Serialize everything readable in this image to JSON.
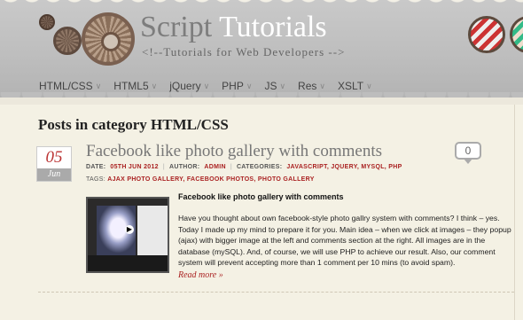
{
  "header": {
    "title_part1": "Script",
    "title_part2": "Tutorials",
    "tagline": "<!--Tutorials for Web Developers -->"
  },
  "nav": {
    "items": [
      {
        "label": "HTML/CSS"
      },
      {
        "label": "HTML5"
      },
      {
        "label": "jQuery"
      },
      {
        "label": "PHP"
      },
      {
        "label": "JS"
      },
      {
        "label": "Res"
      },
      {
        "label": "XSLT"
      }
    ],
    "chevron": "∨"
  },
  "page": {
    "heading": "Posts in category HTML/CSS"
  },
  "post": {
    "day": "05",
    "month": "Jun",
    "title": "Facebook like photo gallery with comments",
    "comment_count": "0",
    "meta": {
      "date_label": "DATE:",
      "date_value": "05TH JUN 2012",
      "author_label": "AUTHOR:",
      "author_value": "ADMIN",
      "categories_label": "CATEGORIES:",
      "categories_value": "JAVASCRIPT, JQUERY, MYSQL, PHP",
      "separator": "|"
    },
    "tags": {
      "label": "TAGS:",
      "value": "AJAX PHOTO GALLERY, FACEBOOK PHOTOS, PHOTO GALLERY"
    },
    "excerpt_title": "Facebook like photo gallery with comments",
    "excerpt": "Have you thought about own facebook-style photo gallry system with comments? I think – yes. Today I made up my mind to prepare it for you. Main idea – when we click at images – they popup (ajax) with bigger image at the left and comments section at the right. All images are in the database (mySQL). And, of course, we will use PHP to achieve our result. Also, our comment system will prevent accepting more than 1 comment per 10 mins (to avoid spam).",
    "read_more": "Read more »"
  },
  "colors": {
    "accent_red": "#aa2222",
    "header_gray": "#bdbdbd",
    "background": "#f4f1e4"
  }
}
